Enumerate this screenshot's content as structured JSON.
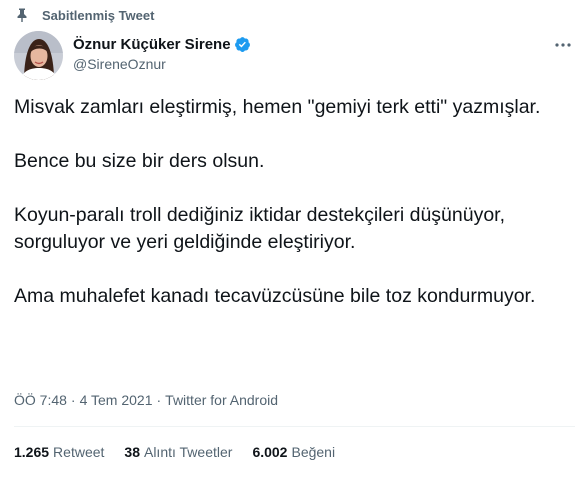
{
  "pinned": {
    "label": "Sabitlenmiş Tweet",
    "icon": "pin-icon"
  },
  "user": {
    "display_name": "Öznur Küçüker Sirene",
    "handle": "@SireneOznur",
    "verified_icon": "verified-badge-icon",
    "verified_color": "#1d9bf0"
  },
  "more_icon": "more-dots-icon",
  "tweet": {
    "paragraphs": [
      "Misvak zamları eleştirmiş, hemen \"gemiyi terk etti\" yazmışlar.",
      "Bence bu size bir ders olsun.",
      "Koyun-paralı troll dediğiniz iktidar destekçileri düşünüyor, sorguluyor ve yeri geldiğinde eleştiriyor.",
      "Ama muhalefet kanadı tecavüzcüsüne bile toz kondurmuyor."
    ]
  },
  "meta": {
    "time": "ÖÖ 7:48",
    "separator": "·",
    "date": "4 Tem 2021",
    "source": "Twitter for Android"
  },
  "stats": {
    "retweets": {
      "count": "1.265",
      "label": "Retweet"
    },
    "quotes": {
      "count": "38",
      "label": "Alıntı Tweetler"
    },
    "likes": {
      "count": "6.002",
      "label": "Beğeni"
    }
  },
  "colors": {
    "secondary_text": "#536471",
    "primary_text": "#0f1419",
    "divider": "#eff3f4"
  }
}
